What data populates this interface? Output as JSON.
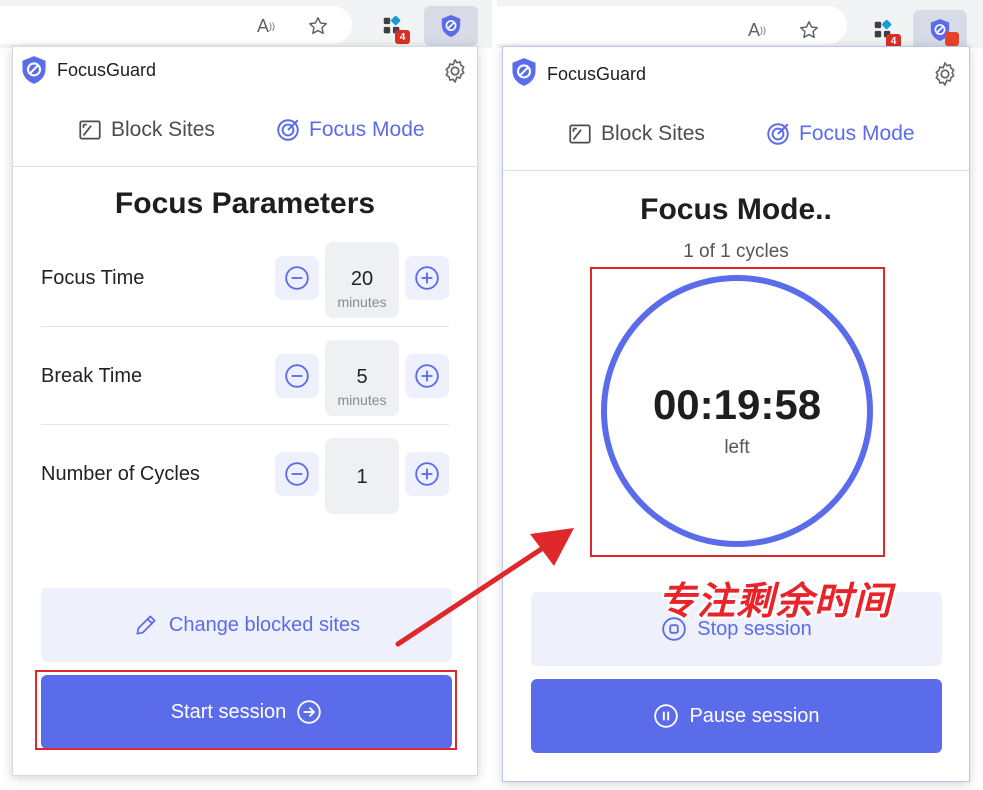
{
  "browser": {
    "read_aloud_glyph": "A",
    "extension_badge_count": "4"
  },
  "app": {
    "name": "FocusGuard"
  },
  "tabs": {
    "block_sites": "Block Sites",
    "focus_mode": "Focus Mode"
  },
  "left_panel": {
    "title": "Focus Parameters",
    "params": [
      {
        "label": "Focus Time",
        "value": "20",
        "unit": "minutes"
      },
      {
        "label": "Break Time",
        "value": "5",
        "unit": "minutes"
      },
      {
        "label": "Number of Cycles",
        "value": "1",
        "unit": ""
      }
    ],
    "change_blocked_sites_label": "Change blocked sites",
    "start_session_label": "Start session"
  },
  "right_panel": {
    "title": "Focus Mode..",
    "cycles_text": "1 of 1 cycles",
    "timer_value": "00:19:58",
    "timer_suffix": "left",
    "stop_session_label": "Stop session",
    "pause_session_label": "Pause session"
  },
  "annotation": {
    "caption": "专注剩余时间"
  },
  "colors": {
    "accent": "#5b6cea",
    "highlight": "#e0272b",
    "light_button": "#eef0fb"
  }
}
